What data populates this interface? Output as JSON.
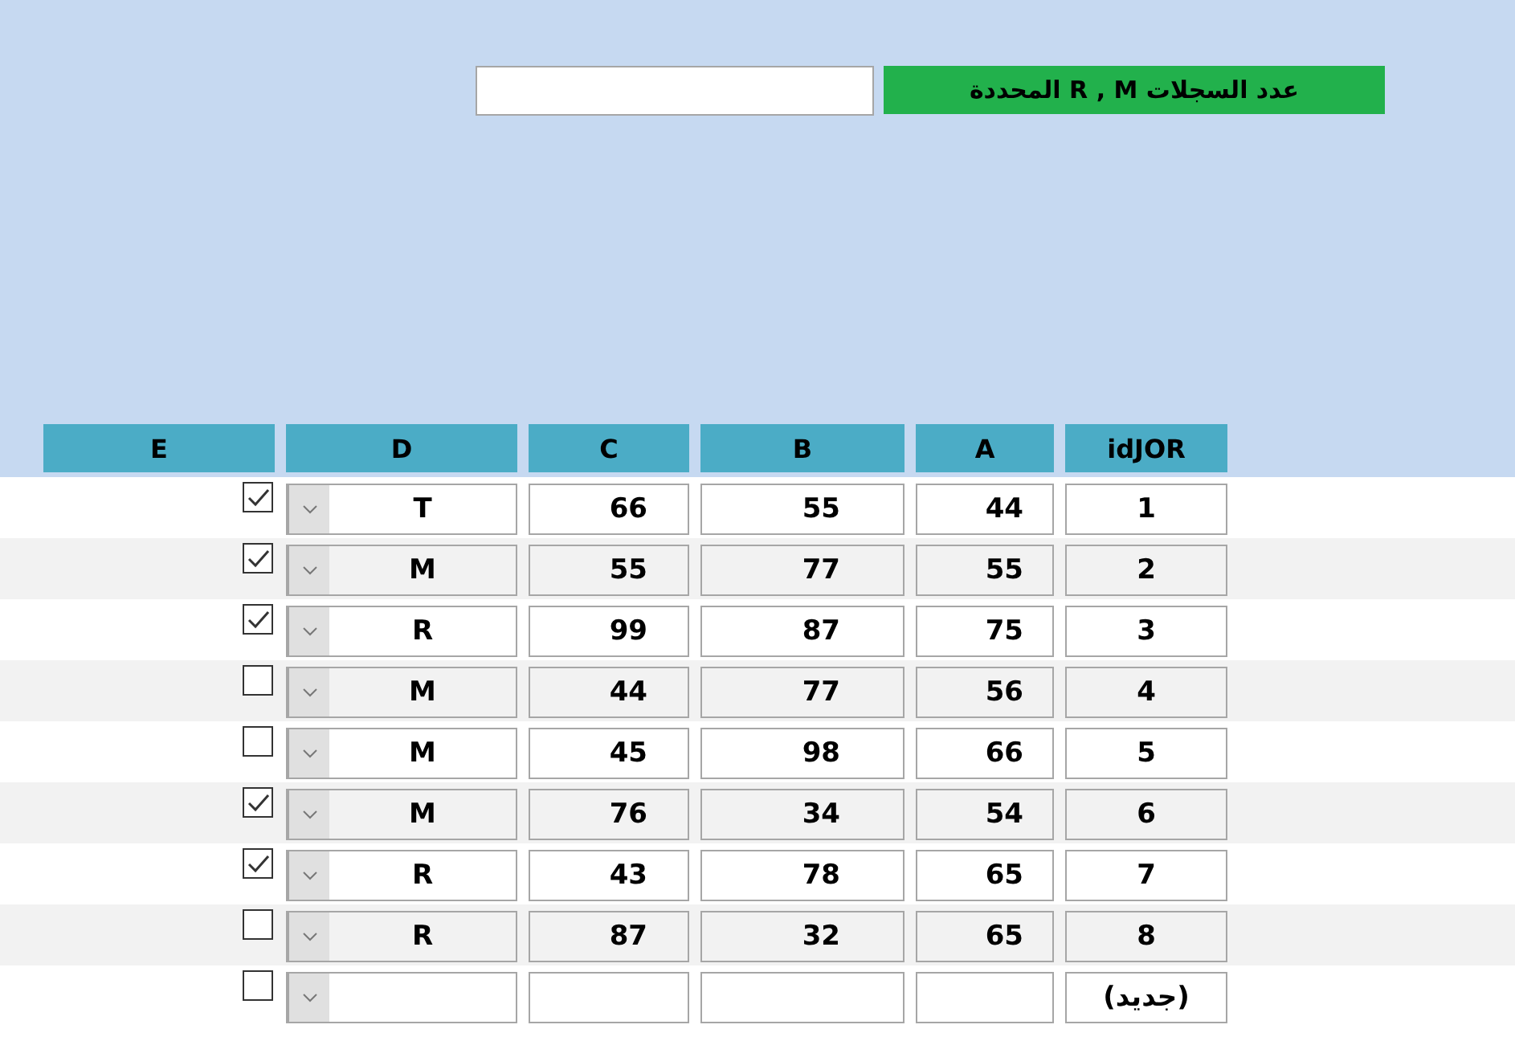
{
  "header": {
    "label": "عدد السجلات R , M المحددة"
  },
  "columns": [
    "idJOR",
    "A",
    "B",
    "C",
    "D",
    "E"
  ],
  "rows": [
    {
      "id": "1",
      "a": "44",
      "b": "55",
      "c": "66",
      "d": "T",
      "checked": true
    },
    {
      "id": "2",
      "a": "55",
      "b": "77",
      "c": "55",
      "d": "M",
      "checked": true
    },
    {
      "id": "3",
      "a": "75",
      "b": "87",
      "c": "99",
      "d": "R",
      "checked": true
    },
    {
      "id": "4",
      "a": "56",
      "b": "77",
      "c": "44",
      "d": "M",
      "checked": false
    },
    {
      "id": "5",
      "a": "66",
      "b": "98",
      "c": "45",
      "d": "M",
      "checked": false
    },
    {
      "id": "6",
      "a": "54",
      "b": "34",
      "c": "76",
      "d": "M",
      "checked": true
    },
    {
      "id": "7",
      "a": "65",
      "b": "78",
      "c": "43",
      "d": "R",
      "checked": true
    },
    {
      "id": "8",
      "a": "65",
      "b": "32",
      "c": "87",
      "d": "R",
      "checked": false
    },
    {
      "id": "(جديد)",
      "checked": false
    }
  ]
}
